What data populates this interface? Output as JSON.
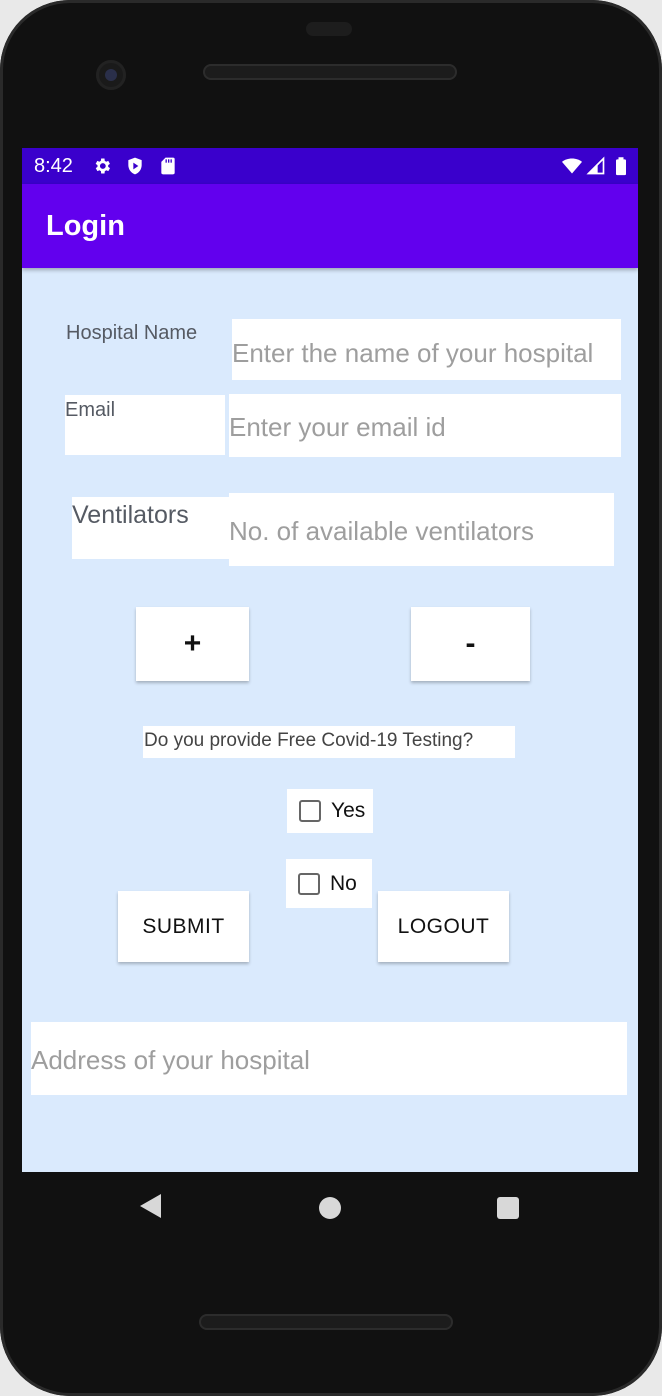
{
  "status_bar": {
    "time": "8:42",
    "left_icons": [
      "gear-icon",
      "shield-icon",
      "sd-card-icon"
    ],
    "right_icons": [
      "wifi-icon",
      "signal-icon",
      "battery-icon"
    ]
  },
  "app_bar": {
    "title": "Login"
  },
  "form": {
    "hospital_name_label": "Hospital Name",
    "hospital_name_placeholder": "Enter the name of your hospital",
    "hospital_name_value": "",
    "email_label": "Email",
    "email_placeholder": "Enter your email id",
    "email_value": "",
    "ventilators_label": "Ventilators",
    "ventilators_placeholder": "No. of available ventilators",
    "ventilators_value": "",
    "increment_label": "+",
    "decrement_label": "-",
    "testing_question": "Do you provide Free Covid-19 Testing?",
    "yes_label": "Yes",
    "yes_checked": false,
    "no_label": "No",
    "no_checked": false,
    "submit_label": "SUBMIT",
    "logout_label": "LOGOUT",
    "address_placeholder": "Address of your hospital",
    "address_value": ""
  },
  "nav_bar": {
    "icons": [
      "back-icon",
      "home-icon",
      "recents-icon"
    ]
  },
  "colors": {
    "status_bar": "#3a00cc",
    "app_bar": "#6200ee",
    "background": "#daeafd"
  }
}
